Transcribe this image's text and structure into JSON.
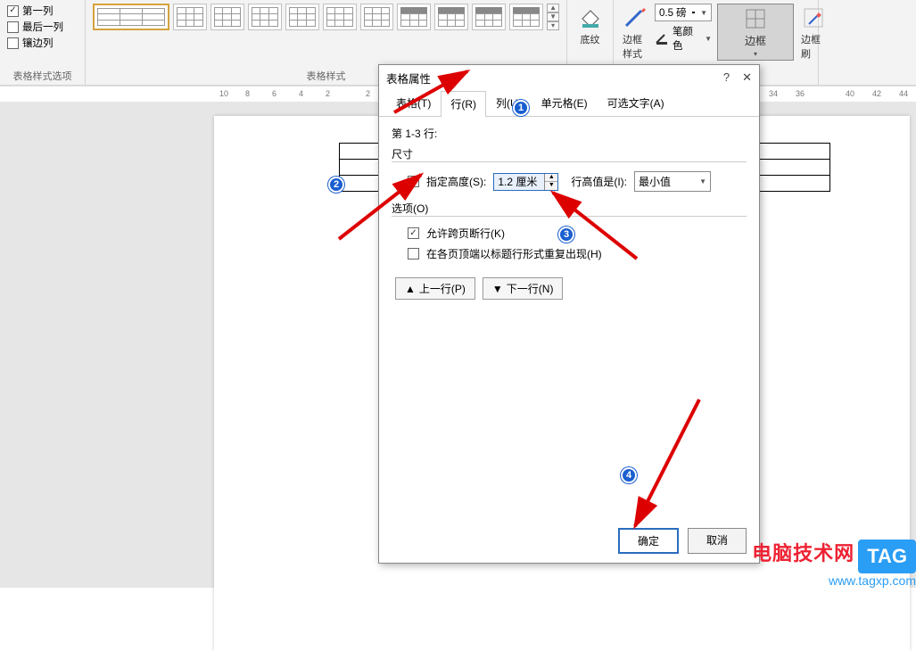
{
  "ribbon": {
    "style_options": {
      "first_col": "第一列",
      "last_col": "最后一列",
      "banded_cols": "镶边列",
      "group_label": "表格样式选项"
    },
    "table_styles_label": "表格样式",
    "shading_label": "底纹",
    "border_styles_label": "边框样式",
    "weight_value": "0.5 磅",
    "pen_color_label": "笔颜色",
    "borders_btn": "边框",
    "border_painter_btn": "边框刷"
  },
  "ruler_ticks": [
    "10",
    "8",
    "6",
    "4",
    "2",
    "2",
    "34",
    "36",
    "40",
    "42",
    "44"
  ],
  "dialog": {
    "title": "表格属性",
    "help": "?",
    "close": "✕",
    "tabs": {
      "table": "表格(T)",
      "row": "行(R)",
      "column": "列(U)",
      "cell": "单元格(E)",
      "alt_text": "可选文字(A)"
    },
    "rows_heading": "第 1-3 行:",
    "size_legend": "尺寸",
    "specify_height": "指定高度(S):",
    "height_value": "1.2 厘米",
    "row_height_is": "行高值是(I):",
    "row_height_mode": "最小值",
    "options_legend": "选项(O)",
    "allow_break": "允许跨页断行(K)",
    "repeat_header": "在各页顶端以标题行形式重复出现(H)",
    "prev_row": "上一行(P)",
    "next_row": "下一行(N)",
    "ok": "确定",
    "cancel": "取消"
  },
  "badges": {
    "b1": "1",
    "b2": "2",
    "b3": "3",
    "b4": "4"
  },
  "wm": {
    "line1": "电脑技术网",
    "tag": "TAG",
    "line2": "www.tagxp.com"
  }
}
